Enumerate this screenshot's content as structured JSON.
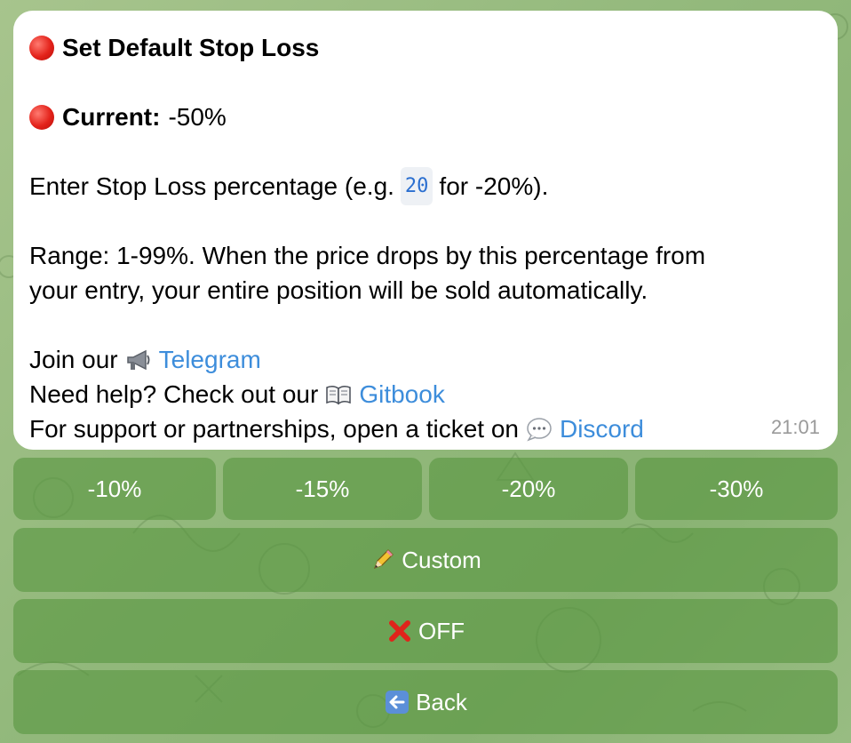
{
  "message": {
    "title": "Set Default Stop Loss",
    "current_label": "Current:",
    "current_value": "-50%",
    "enter_text_before": "Enter Stop Loss percentage (e.g.",
    "enter_code": "20",
    "enter_text_after": "for -20%).",
    "range_line1": "Range: 1-99%. When the price drops by this percentage from",
    "range_line2": "your entry, your entire position will be sold automatically.",
    "join_text": "Join our",
    "telegram_link": "Telegram",
    "help_text": "Need help? Check out our",
    "gitbook_link": "Gitbook",
    "support_text": "For support or partnerships, open a ticket on",
    "discord_link": "Discord",
    "time": "21:01",
    "icons": [
      "red-circle",
      "megaphone",
      "open-book",
      "speech-bubble"
    ]
  },
  "keyboard": {
    "row1": [
      "-10%",
      "-15%",
      "-20%",
      "-30%"
    ],
    "custom": "Custom",
    "off": "OFF",
    "back": "Back",
    "icons": [
      "pencil",
      "cross-mark",
      "left-arrow"
    ]
  },
  "colors": {
    "button_bg": "#6fa557",
    "link": "#3d8ddb",
    "code": "#2b6fd0"
  }
}
